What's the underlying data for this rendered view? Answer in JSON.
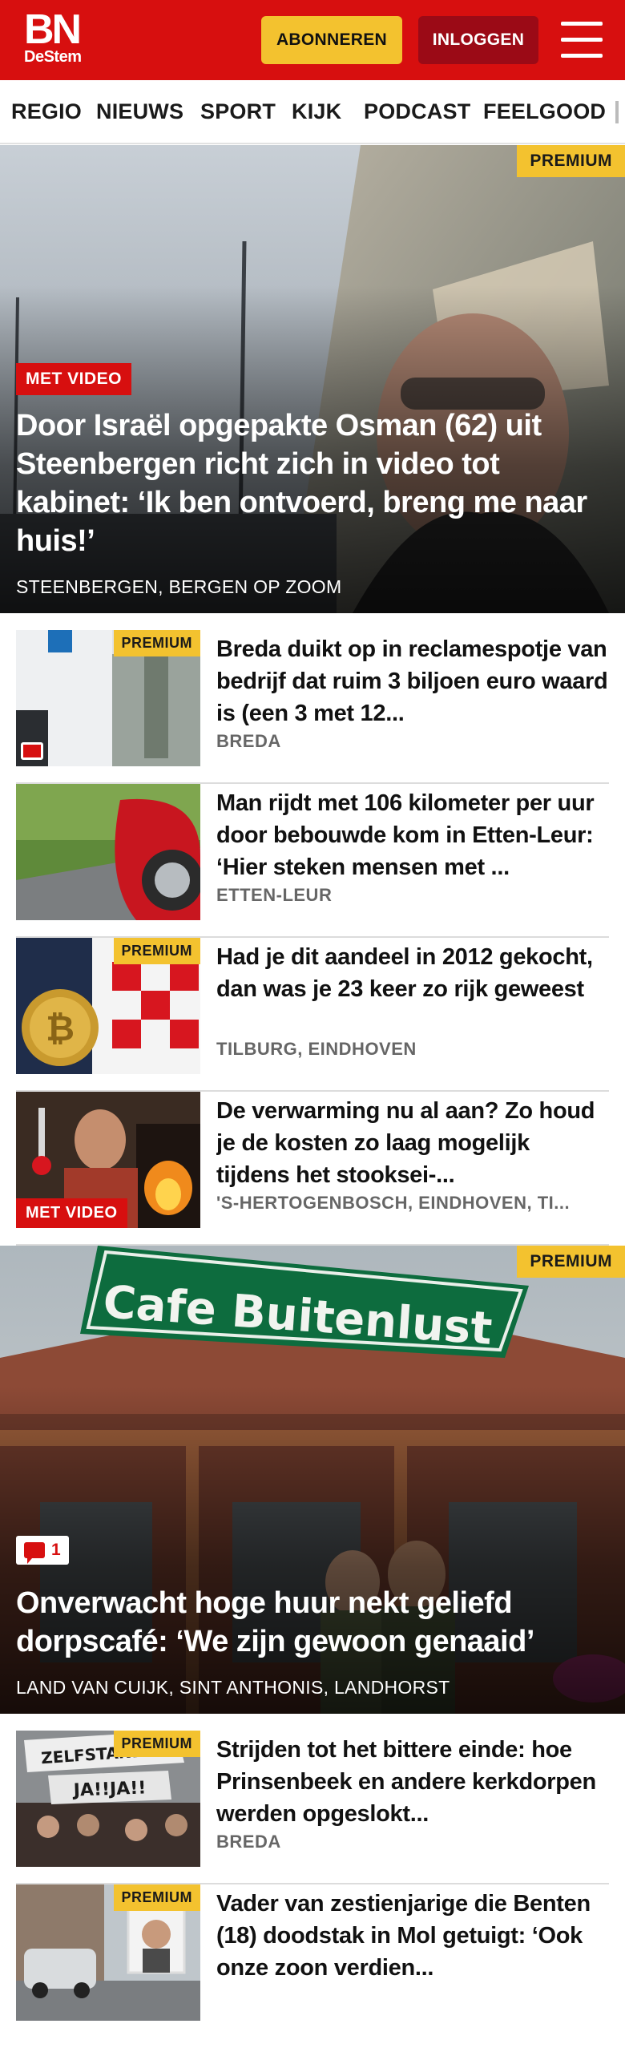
{
  "header": {
    "logo_main": "BN",
    "logo_sub": "DeStem",
    "subscribe_label": "ABONNEREN",
    "login_label": "INLOGGEN",
    "menu_icon": "hamburger-menu-icon"
  },
  "nav": {
    "items": [
      "REGIO",
      "NIEUWS",
      "SPORT",
      "KIJK",
      "PODCAST",
      "FEELGOOD"
    ]
  },
  "hero1": {
    "badge": "PREMIUM",
    "video_label": "MET VIDEO",
    "title": "Door Israël opgepakte Osman (62) uit Steenbergen richt zich in video tot kabinet: ‘Ik ben ontvoerd, breng me naar huis!’",
    "location": "STEENBERGEN, BERGEN OP ZOOM"
  },
  "list1": [
    {
      "badge": "PREMIUM",
      "title": "Breda duikt op in reclamespotje van bedrijf dat ruim 3 biljoen euro waard is (een 3 met 12...",
      "location": "BREDA",
      "comments": true
    },
    {
      "badge": "",
      "title": "Man rijdt met 106 kilometer per uur door bebouwde kom in Etten-Leur: ‘Hier steken mensen met ...",
      "location": "ETTEN-LEUR"
    },
    {
      "badge": "PREMIUM",
      "title": "Had je dit aandeel in 2012 gekocht, dan was je 23 keer zo rijk geweest",
      "location": "TILBURG, EINDHOVEN"
    },
    {
      "badge": "",
      "video_label": "MET VIDEO",
      "title": "De verwarming nu al aan? Zo houd je de kosten zo laag mogelijk tijdens het stooksei-...",
      "location": "'S-HERTOGENBOSCH, EINDHOVEN, TI..."
    }
  ],
  "hero2": {
    "badge": "PREMIUM",
    "sign_text": "Cafe Buitenlust",
    "comment_count": "1",
    "title": "Onverwacht hoge huur nekt geliefd dorpscafé: ‘We zijn gewoon genaaid’",
    "location": "LAND VAN CUIJK, SINT ANTHONIS, LANDHORST"
  },
  "list2": [
    {
      "badge": "PREMIUM",
      "title": "Strijden tot het bittere einde: hoe Prinsenbeek en andere kerkdorpen werden opgeslokt...",
      "location": "BREDA",
      "banner_text_1": "ZELFSTANDIG",
      "banner_text_2": "JA!!JA!!"
    },
    {
      "badge": "PREMIUM",
      "title": "Vader van zestienjarige die Benten (18) doodstak in Mol getuigt: ‘Ook onze zoon verdien...",
      "location": ""
    }
  ],
  "colors": {
    "brand_red": "#d70f0f",
    "premium_yellow": "#f3c22f",
    "login_dark_red": "#9b0a16"
  }
}
